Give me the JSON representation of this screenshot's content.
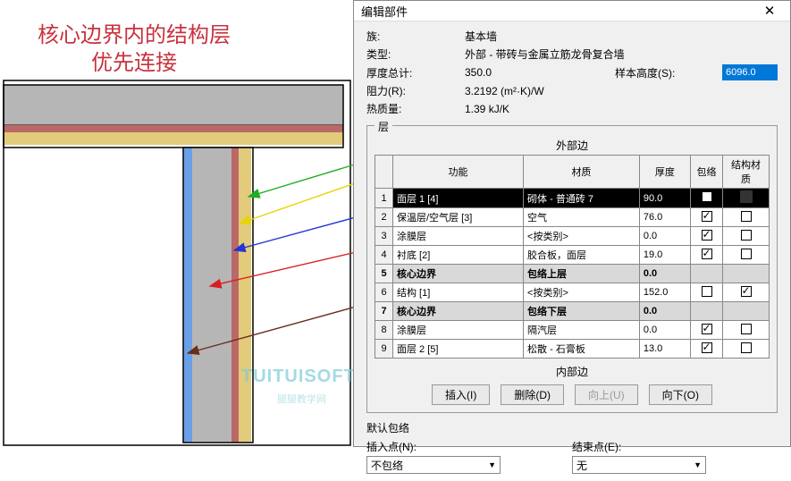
{
  "annotation": {
    "line1": "核心边界内的结构层",
    "line2": "优先连接"
  },
  "dialog": {
    "title": "编辑部件",
    "props": {
      "family_lbl": "族:",
      "family_val": "基本墙",
      "type_lbl": "类型:",
      "type_val": "外部 - 带砖与金属立筋龙骨复合墙",
      "total_lbl": "厚度总计:",
      "total_val": "350.0",
      "sample_lbl": "样本高度(S):",
      "sample_val": "6096.0",
      "r_lbl": "阻力(R):",
      "r_val": "3.2192 (m²·K)/W",
      "mass_lbl": "热质量:",
      "mass_val": "1.39 kJ/K"
    },
    "layers": {
      "caption": "层",
      "outer": "外部边",
      "inner": "内部边",
      "headers": {
        "func": "功能",
        "mat": "材质",
        "thk": "厚度",
        "wrap": "包络",
        "struct": "结构材质"
      },
      "rows": [
        {
          "n": "1",
          "func": "面层 1 [4]",
          "mat": "砌体 - 普通砖 7",
          "thk": "90.0",
          "wrap": true,
          "swatch": true,
          "sel": true
        },
        {
          "n": "2",
          "func": "保温层/空气层 [3]",
          "mat": "空气",
          "thk": "76.0",
          "wrap": true
        },
        {
          "n": "3",
          "func": "涂膜层",
          "mat": "<按类别>",
          "thk": "0.0",
          "wrap": true
        },
        {
          "n": "4",
          "func": "衬底 [2]",
          "mat": "胶合板，面层",
          "thk": "19.0",
          "wrap": true
        },
        {
          "n": "5",
          "func": "核心边界",
          "mat": "包络上层",
          "thk": "0.0",
          "core": true
        },
        {
          "n": "6",
          "func": "结构 [1]",
          "mat": "<按类别>",
          "thk": "152.0",
          "struct": true
        },
        {
          "n": "7",
          "func": "核心边界",
          "mat": "包络下层",
          "thk": "0.0",
          "core": true
        },
        {
          "n": "8",
          "func": "涂膜层",
          "mat": "隔汽层",
          "thk": "0.0",
          "wrap": true
        },
        {
          "n": "9",
          "func": "面层 2 [5]",
          "mat": "松散 - 石膏板",
          "thk": "13.0",
          "wrap": true
        }
      ]
    },
    "buttons": {
      "insert": "插入(I)",
      "delete": "删除(D)",
      "up": "向上(U)",
      "down": "向下(O)"
    },
    "wrap": {
      "title": "默认包络",
      "ins_lbl": "插入点(N):",
      "ins_val": "不包络",
      "end_lbl": "结束点(E):",
      "end_val": "无"
    }
  },
  "watermark": {
    "main": "TUITUISOFT",
    "sub": "腿腿教学网"
  }
}
